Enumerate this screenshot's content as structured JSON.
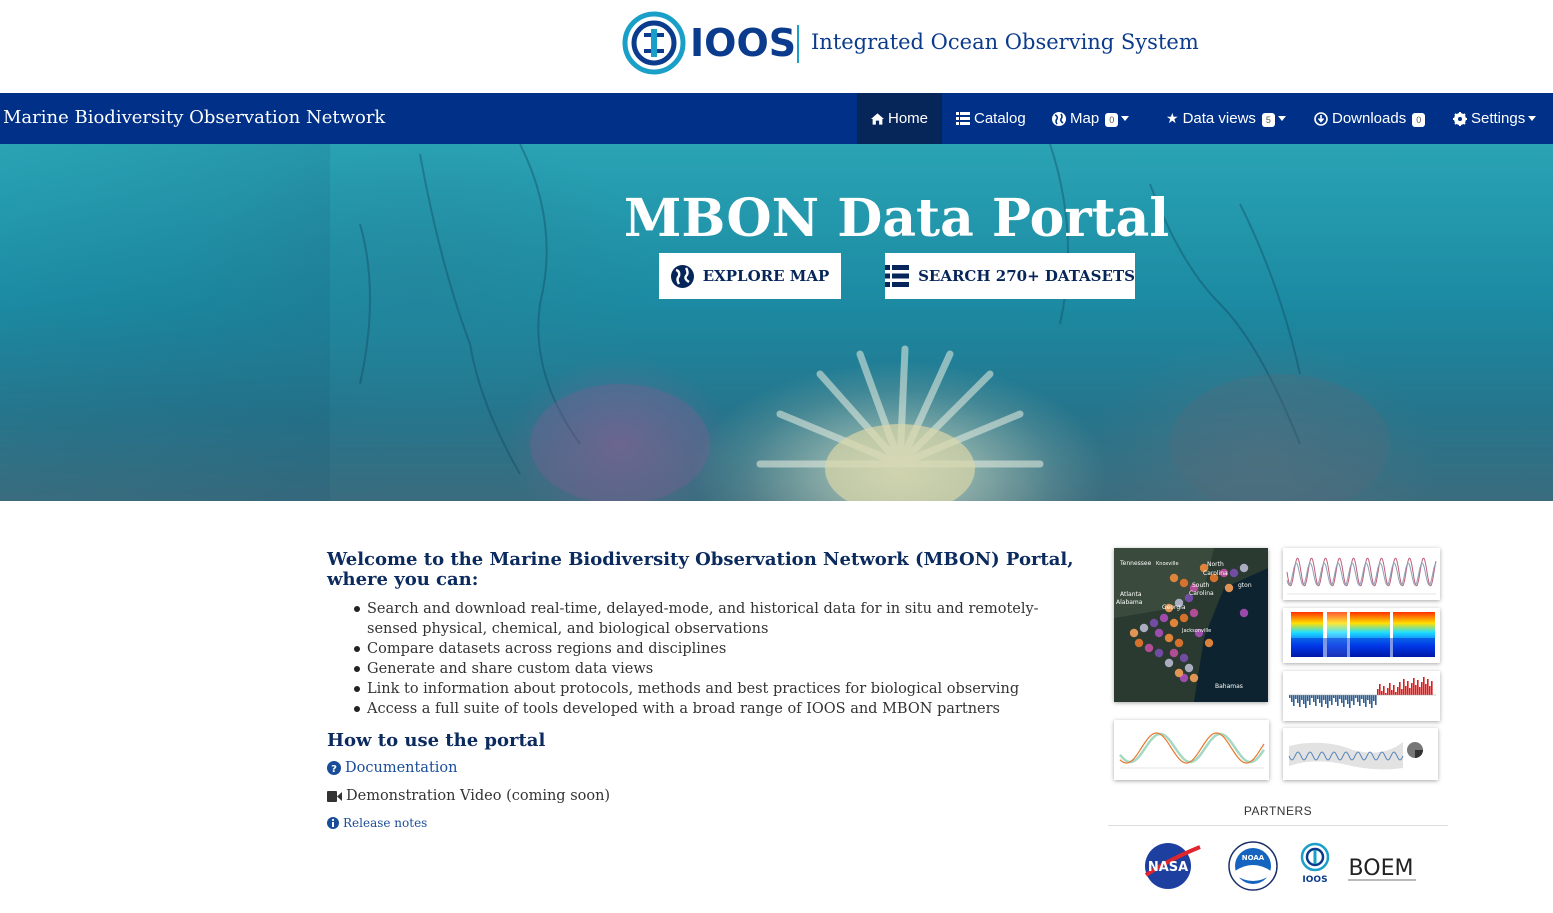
{
  "logo": {
    "wordmark": "IOOS",
    "tagline": "Integrated Ocean Observing System"
  },
  "navbar": {
    "brand": "Marine Biodiversity Observation Network",
    "items": [
      {
        "label": "Home",
        "icon": "home-icon",
        "active": true
      },
      {
        "label": "Catalog",
        "icon": "list-icon"
      },
      {
        "label": "Map",
        "icon": "globe-icon",
        "badge": "0",
        "dropdown": true
      },
      {
        "label": "Data views",
        "icon": "star-icon",
        "badge": "5",
        "dropdown": true
      },
      {
        "label": "Downloads",
        "icon": "download-icon",
        "badge": "0"
      },
      {
        "label": "Settings",
        "icon": "gear-icon",
        "dropdown": true
      }
    ]
  },
  "hero": {
    "title": "MBON Data Portal",
    "explore_label": "EXPLORE MAP",
    "search_label": "SEARCH 270+ DATASETS"
  },
  "main": {
    "welcome": "Welcome to the Marine Biodiversity Observation Network (MBON) Portal, where you can:",
    "bullets": [
      "Search and download real-time, delayed-mode, and historical data for in situ and remotely-sensed physical, chemical, and biological observations",
      "Compare datasets across regions and disciplines",
      "Generate and share custom data views",
      "Link to information about protocols, methods and best practices for biological observing",
      "Access a full suite of tools developed with a broad range of IOOS and MBON partners"
    ],
    "howto_title": "How to use the portal",
    "documentation": "Documentation",
    "video": "Demonstration Video (coming soon)",
    "release_notes": "Release notes"
  },
  "partners": {
    "label": "PARTNERS",
    "logos": [
      "NASA",
      "NOAA",
      "IOOS",
      "BOEM"
    ]
  },
  "map_thumb_labels": [
    "Tennessee",
    "Knoxville",
    "North",
    "Carolina",
    "South",
    "Carolina",
    "Atlanta",
    "Alabama",
    "Georgia",
    "Jacksonville",
    "Bahamas",
    "gton"
  ]
}
